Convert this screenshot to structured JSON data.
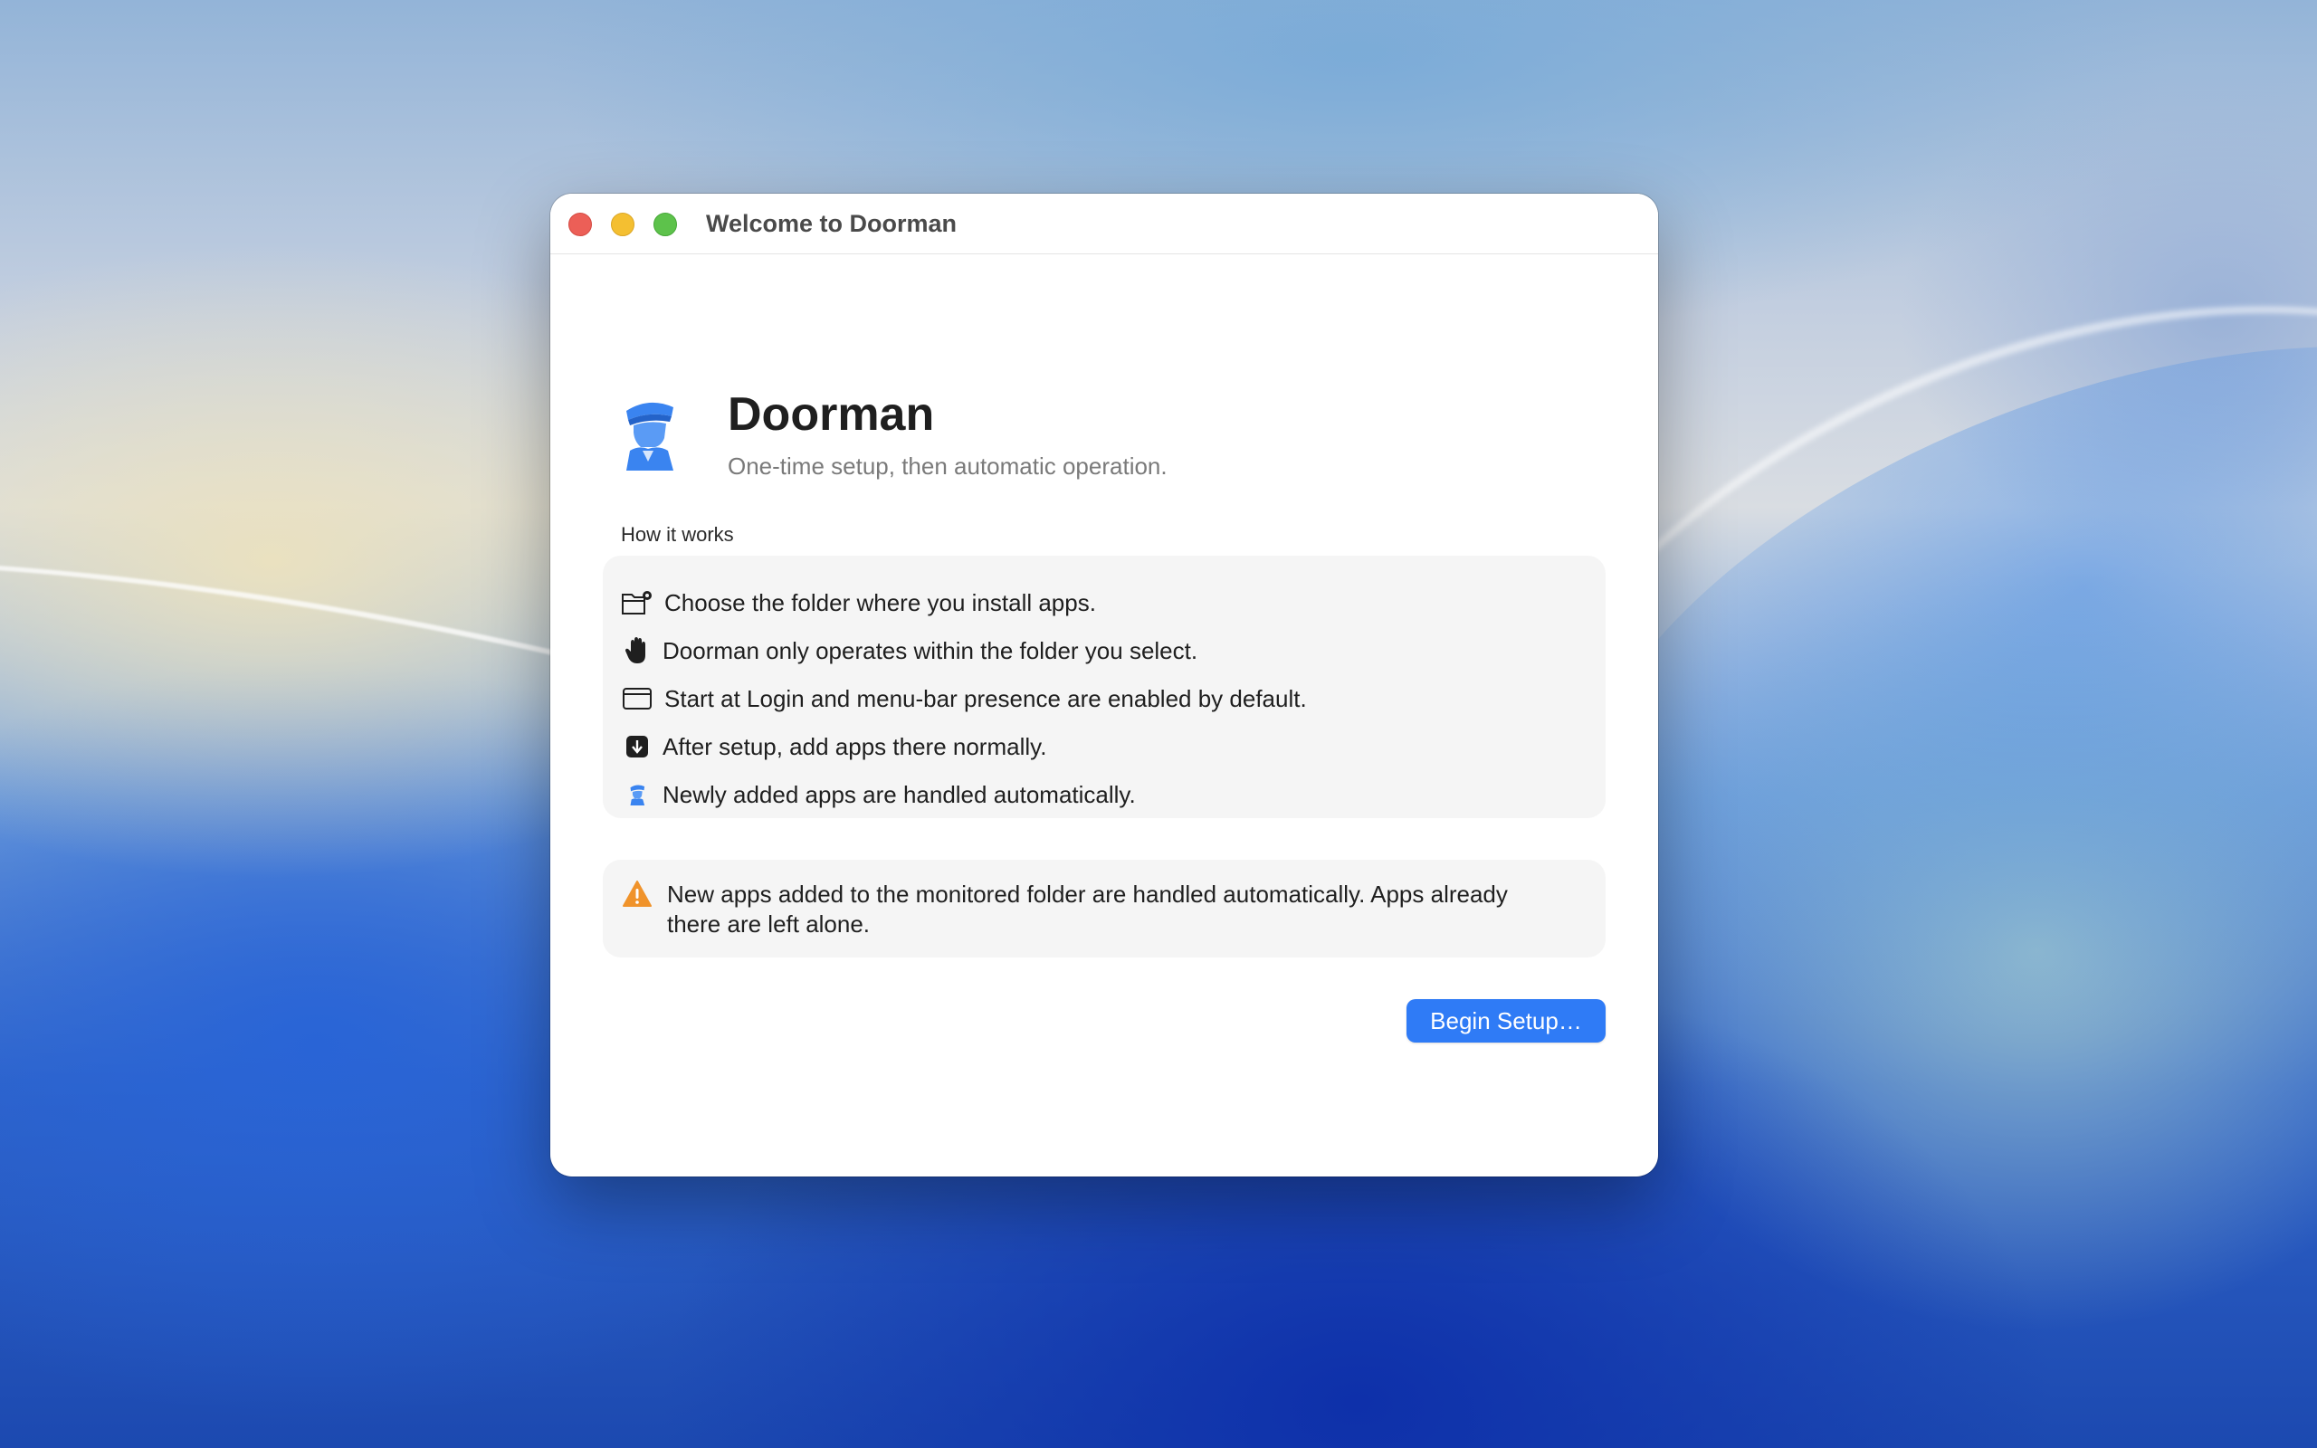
{
  "window": {
    "title": "Welcome to Doorman"
  },
  "header": {
    "app_name": "Doorman",
    "subtitle": "One-time setup, then automatic operation."
  },
  "how_it_works": {
    "label": "How it works",
    "items": [
      {
        "icon": "folder-badge-gear-icon",
        "text": "Choose the folder where you install apps."
      },
      {
        "icon": "hand-raised-icon",
        "text": "Doorman only operates within the folder you select."
      },
      {
        "icon": "window-icon",
        "text": "Start at Login and menu-bar presence are enabled by default."
      },
      {
        "icon": "arrow-down-square-icon",
        "text": "After setup, add apps there normally."
      },
      {
        "icon": "doorman-icon",
        "text": "Newly added apps are handled automatically."
      }
    ]
  },
  "warning": {
    "icon": "warning-triangle-icon",
    "text": "New apps added to the monitored folder are handled automatically. Apps already there are left alone."
  },
  "actions": {
    "begin_label": "Begin Setup…"
  },
  "colors": {
    "accent": "#2f7bf6",
    "logo_blue": "#3a84f0",
    "warning_orange": "#f0932b",
    "close": "#ec5f57",
    "minimize": "#f4bf31",
    "maximize": "#5dc24b"
  }
}
